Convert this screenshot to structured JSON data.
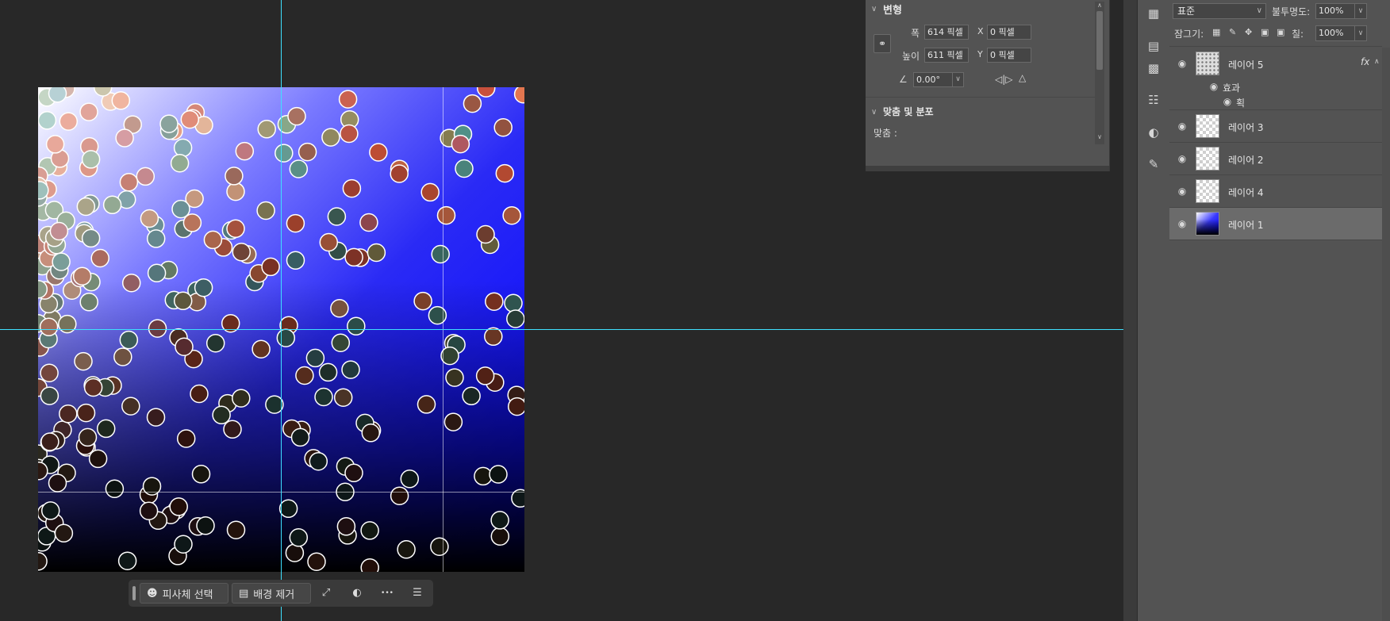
{
  "properties": {
    "transform": {
      "title": "변형",
      "width_label": "폭",
      "width_value": "614 픽셀",
      "height_label": "높이",
      "height_value": "611 픽셀",
      "x_label": "X",
      "x_value": "0 픽셀",
      "y_label": "Y",
      "y_value": "0 픽셀",
      "angle_value": "0.00°"
    },
    "align": {
      "title": "맞춤 및 분포",
      "align_label": "맞춤 :"
    }
  },
  "layers_panel": {
    "blend_mode": "표준",
    "opacity_label": "불투명도:",
    "opacity_value": "100%",
    "lock_label": "잠그기:",
    "fill_label": "칠:",
    "fill_value": "100%",
    "layers": [
      {
        "name": "레이어 5",
        "fx": "fx",
        "effects_label": "효과",
        "effect": "획"
      },
      {
        "name": "레이어 3"
      },
      {
        "name": "레이어 2"
      },
      {
        "name": "레이어 4"
      },
      {
        "name": "레이어 1",
        "selected": true
      }
    ]
  },
  "taskbar": {
    "select_subject": "피사체 선택",
    "remove_background": "배경 제거",
    "more": "•••"
  },
  "icons": {
    "strip": [
      "table-icon",
      "libraries-icon",
      "document-icon",
      "adjustments-icon",
      "masks-icon",
      "brush-settings-icon"
    ]
  },
  "colors": {
    "guide": "#3ee0ff",
    "panel_bg": "#535353",
    "workspace_bg": "#282828",
    "selected_layer": "#6b6b6b"
  }
}
